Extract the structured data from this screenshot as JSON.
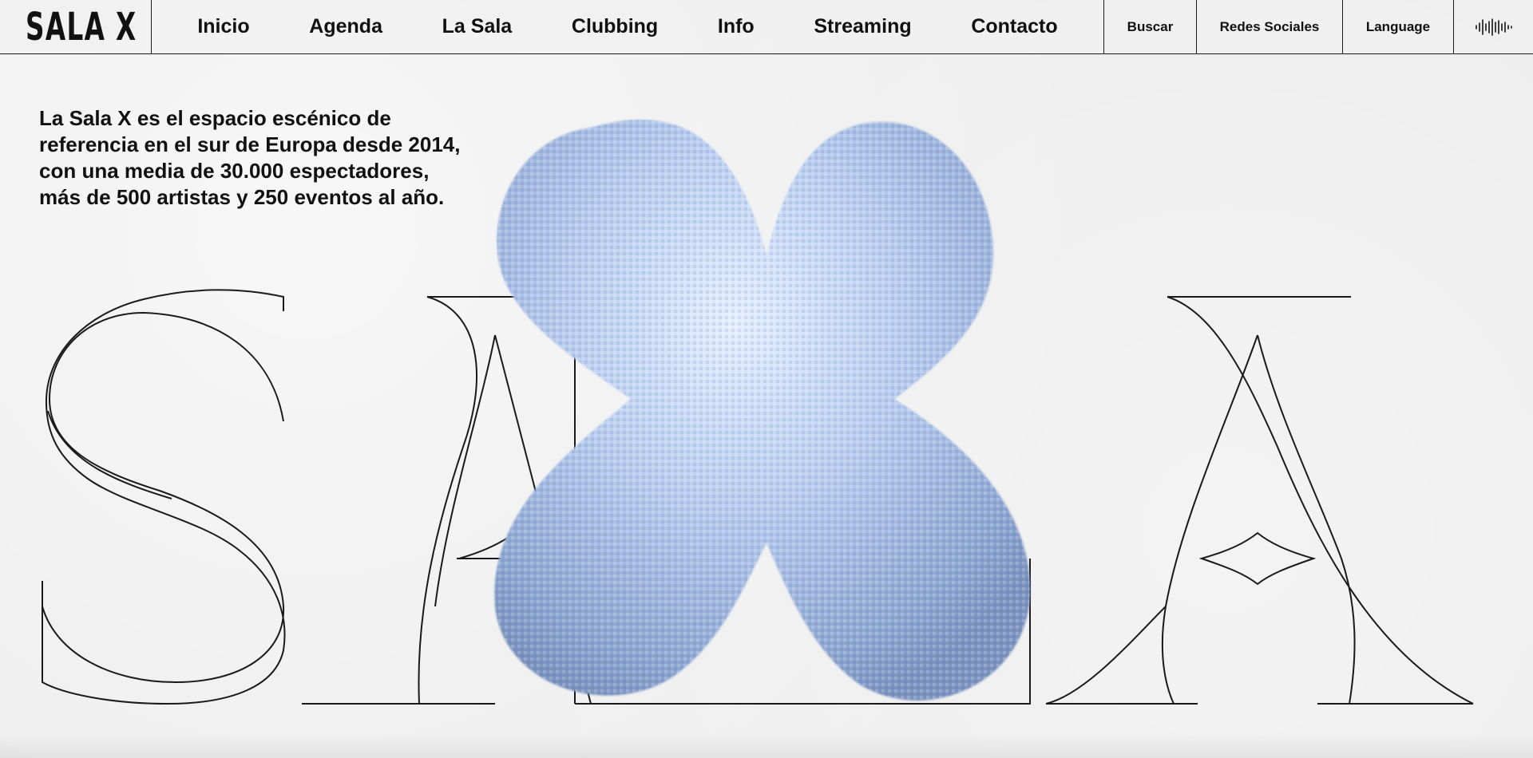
{
  "header": {
    "logo_text": "SALA X",
    "nav": [
      {
        "label": "Inicio"
      },
      {
        "label": "Agenda"
      },
      {
        "label": "La Sala"
      },
      {
        "label": "Clubbing"
      },
      {
        "label": "Info"
      },
      {
        "label": "Streaming"
      },
      {
        "label": "Contacto"
      }
    ],
    "utility": {
      "search_label": "Buscar",
      "social_label": "Redes Sociales",
      "language_label": "Language",
      "audio_icon": "sound-wave-icon"
    }
  },
  "hero": {
    "intro_text": "La Sala X es el espacio escénico de referencia en el sur de Europa desde 2014, con una media de 30.000 espectadores, más de 500 artistas y 250 eventos al año.",
    "outline_letters": [
      "S",
      "A",
      "L",
      "A"
    ],
    "blob_shape": "x-shape-icon",
    "blob_color": "#b9cdef"
  },
  "colors": {
    "background": "#ededed",
    "ink": "#111111"
  }
}
